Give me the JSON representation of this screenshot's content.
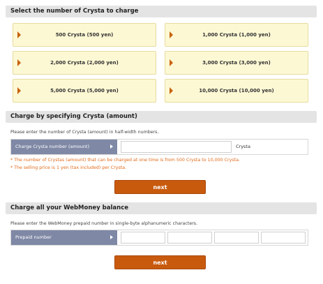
{
  "select_section": {
    "title": "Select the number of Crysta to charge",
    "options": [
      {
        "label": "500 Crysta (500 yen)"
      },
      {
        "label": "1,000 Crysta (1,000 yen)"
      },
      {
        "label": "2,000 Crysta (2,000 yen)"
      },
      {
        "label": "3,000 Crysta (3,000 yen)"
      },
      {
        "label": "5,000 Crysta (5,000 yen)"
      },
      {
        "label": "10,000 Crysta (10,000 yen)"
      }
    ]
  },
  "amount_section": {
    "title": "Charge by specifying Crysta (amount)",
    "description": "Please enter the number of Crysta (amount) in half-width numbers.",
    "field_label": "Charge Crysta number (amount)",
    "input_value": "",
    "unit": "Crysta",
    "notes": [
      "* The number of Crystas (amount) that can be charged at one time is from 500 Crysta to 10,000 Crysta.",
      "* The selling price is 1 yen (tax included) per Crysta."
    ],
    "next_label": "next"
  },
  "webmoney_section": {
    "title": "Charge all your WebMoney balance",
    "description": "Please enter the WebMoney prepaid number in single-byte alphanumeric characters.",
    "field_label": "Prepaid number",
    "inputs": [
      "",
      "",
      "",
      ""
    ],
    "next_label": "next"
  },
  "colors": {
    "option_bg": "#fdf8d4",
    "arrow": "#c8620e",
    "label_bg": "#7f89a6",
    "note": "#e06a1a",
    "next_button": "#c85a0e",
    "header_bg": "#e4e4e4"
  },
  "icons": {
    "option_arrow": "caret-right-icon",
    "label_arrow": "caret-right-icon"
  }
}
